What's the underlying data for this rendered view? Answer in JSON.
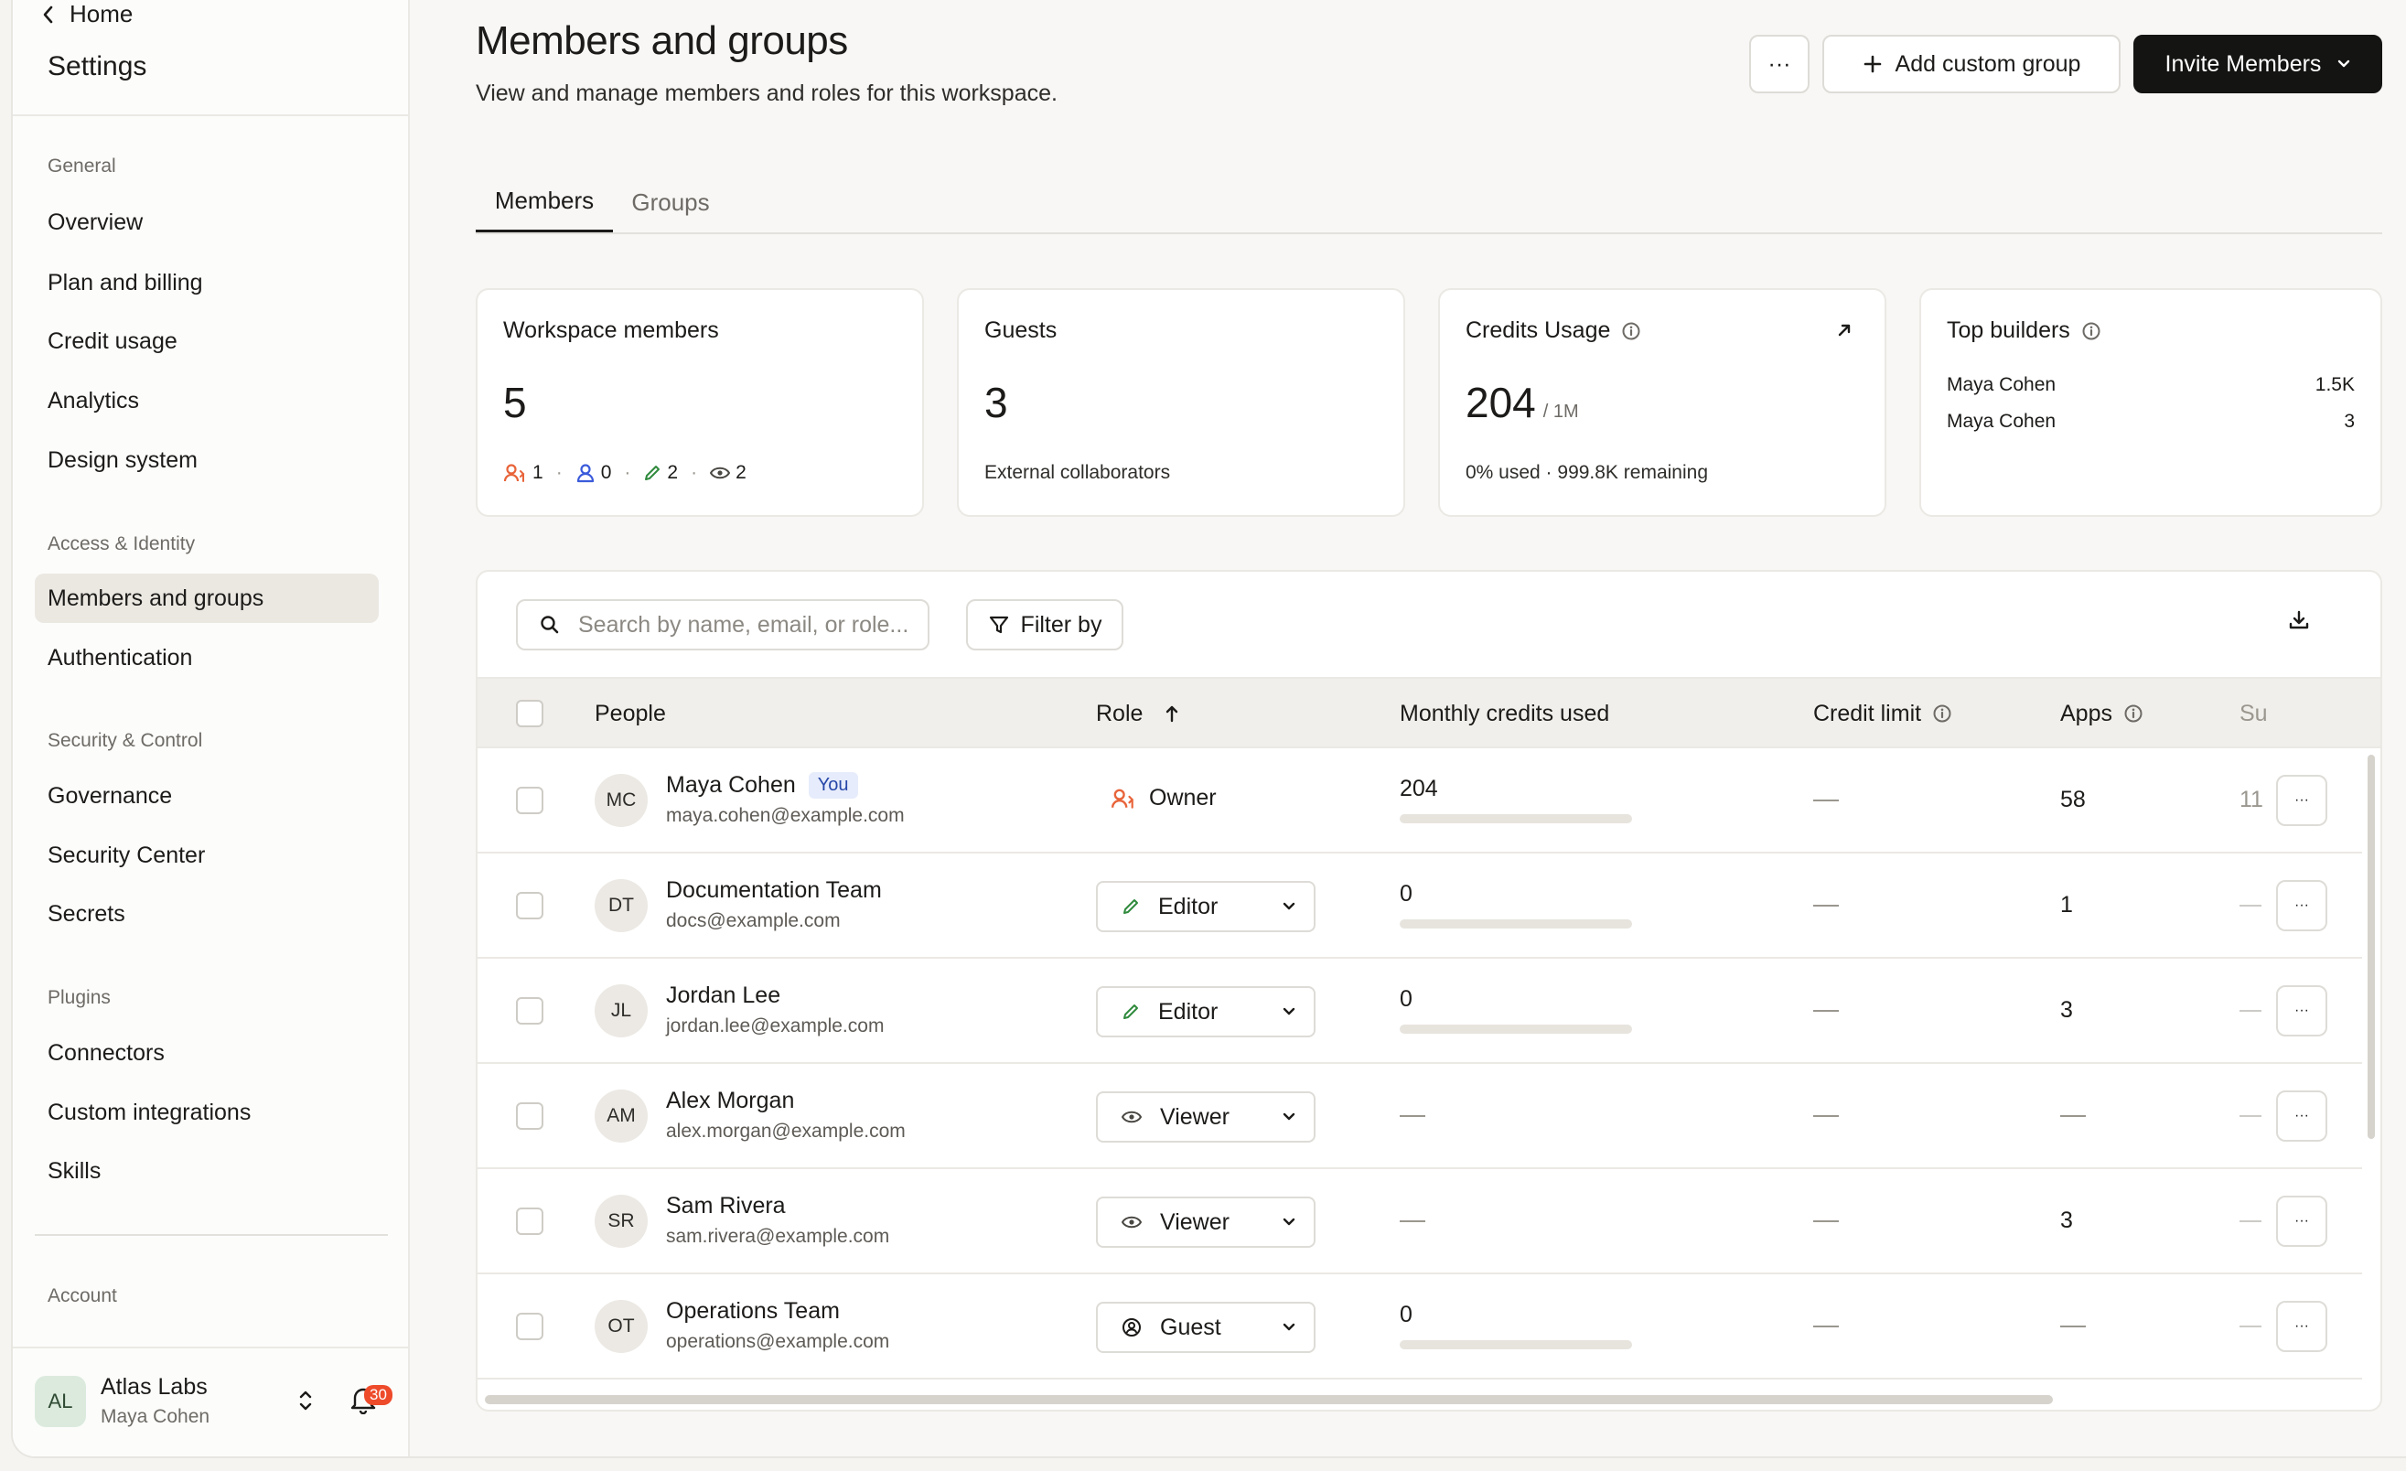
{
  "sidebar": {
    "home_label": "Home",
    "title": "Settings",
    "sections": {
      "general": "General",
      "access": "Access & Identity",
      "security": "Security & Control",
      "plugins": "Plugins",
      "account": "Account"
    },
    "items": {
      "overview": "Overview",
      "plan_billing": "Plan and billing",
      "credit_usage": "Credit usage",
      "analytics": "Analytics",
      "design_system": "Design system",
      "members_groups": "Members and groups",
      "authentication": "Authentication",
      "governance": "Governance",
      "security_center": "Security Center",
      "secrets": "Secrets",
      "connectors": "Connectors",
      "custom_integrations": "Custom integrations",
      "skills": "Skills"
    },
    "workspace": {
      "initials": "AL",
      "name": "Atlas Labs",
      "user": "Maya Cohen",
      "notification_count": "30"
    }
  },
  "header": {
    "title": "Members and groups",
    "subtitle": "View and manage members and roles for this workspace.",
    "more_label": "···",
    "add_group_label": "Add custom group",
    "invite_label": "Invite Members"
  },
  "tabs": {
    "members": "Members",
    "groups": "Groups"
  },
  "cards": {
    "members": {
      "title": "Workspace members",
      "value": "5",
      "owners": "1",
      "admins": "0",
      "editors": "2",
      "viewers": "2"
    },
    "guests": {
      "title": "Guests",
      "value": "3",
      "subtitle": "External collaborators"
    },
    "credits": {
      "title": "Credits Usage",
      "value": "204",
      "unit": "/ 1M",
      "subtitle": "0% used · 999.8K remaining"
    },
    "builders": {
      "title": "Top builders",
      "rows": [
        {
          "name": "Maya Cohen",
          "value": "1.5K"
        },
        {
          "name": "Maya Cohen",
          "value": "3"
        }
      ]
    }
  },
  "table": {
    "search_placeholder": "Search by name, email, or role...",
    "filter_label": "Filter by",
    "columns": {
      "people": "People",
      "role": "Role",
      "monthly": "Monthly credits used",
      "limit": "Credit limit",
      "apps": "Apps",
      "truncated": "Su"
    },
    "dash": "—",
    "you_label": "You",
    "rows": [
      {
        "initials": "MC",
        "name": "Maya Cohen",
        "email": "maya.cohen@example.com",
        "role": "Owner",
        "credits": "204",
        "credit_fraction": 0.0002,
        "apps": "58",
        "trunc": "11"
      },
      {
        "initials": "DT",
        "name": "Documentation Team",
        "email": "docs@example.com",
        "role": "Editor",
        "credits": "0",
        "credit_fraction": 0,
        "apps": "1"
      },
      {
        "initials": "JL",
        "name": "Jordan Lee",
        "email": "jordan.lee@example.com",
        "role": "Editor",
        "credits": "0",
        "credit_fraction": 0,
        "apps": "3"
      },
      {
        "initials": "AM",
        "name": "Alex Morgan",
        "email": "alex.morgan@example.com",
        "role": "Viewer",
        "credits": "",
        "apps": ""
      },
      {
        "initials": "SR",
        "name": "Sam Rivera",
        "email": "sam.rivera@example.com",
        "role": "Viewer",
        "credits": "",
        "apps": "3"
      },
      {
        "initials": "OT",
        "name": "Operations Team",
        "email": "operations@example.com",
        "role": "Guest",
        "credits": "0",
        "credit_fraction": 0,
        "apps": ""
      }
    ]
  },
  "colors": {
    "owner": "#e8643a",
    "admin": "#3b5bdb",
    "editor": "#2f8a3c",
    "badge_bg": "#e6ecfb",
    "accent_dark": "#141412",
    "notification": "#ee4b2b"
  }
}
